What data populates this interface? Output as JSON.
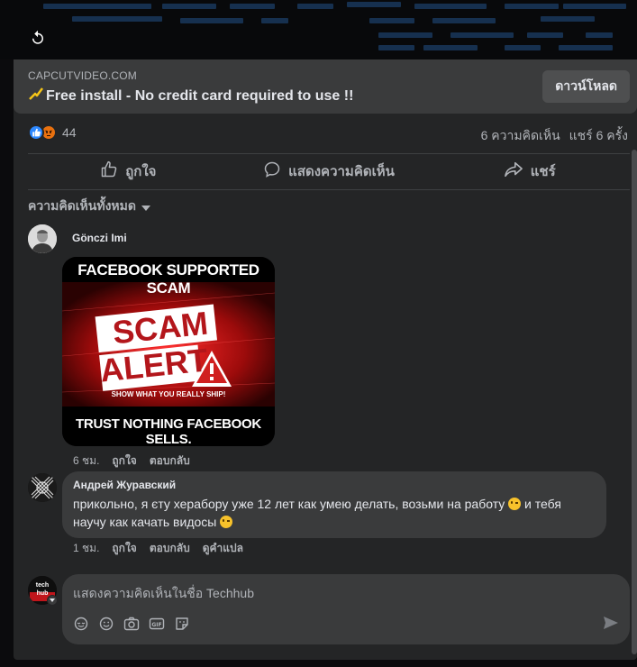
{
  "link": {
    "domain": "CAPCUTVIDEO.COM",
    "title": "Free install - No credit card required to use !!",
    "download_label": "ดาวน์โหลด"
  },
  "reactions": {
    "count": "44",
    "comments": "6 ความคิดเห็น",
    "shares": "แชร์ 6 ครั้ง"
  },
  "actions": {
    "like": "ถูกใจ",
    "comment": "แสดงความคิดเห็น",
    "share": "แชร์"
  },
  "sort_label": "ความคิดเห็นทั้งหมด",
  "comments": [
    {
      "author": "Gönczi Imi",
      "image_text": {
        "top": "FACEBOOK SUPPORTED SCAM",
        "scam": "SCAM",
        "alert": "ALERT",
        "tagline": "SHOW WHAT YOU REALLY SHIP!",
        "bottom": "TRUST NOTHING FACEBOOK SELLS."
      },
      "time": "6 ชม.",
      "like": "ถูกใจ",
      "reply": "ตอบกลับ"
    },
    {
      "author": "Андрей Журавский",
      "text_part1": "прикольно, я єту херабору уже 12 лет как умею делать, возьми на работу",
      "text_part2": " и тебя научу как качать видосы",
      "time": "1 ชม.",
      "like": "ถูกใจ",
      "reply": "ตอบกลับ",
      "translate": "ดูคำแปล"
    }
  ],
  "composer": {
    "placeholder": "แสดงความคิดเห็นในชื่อ Techhub",
    "avatar_text": "tech hub",
    "icons": [
      "sticker-icon",
      "emoji-icon",
      "camera-icon",
      "gif-icon",
      "avatar-sticker-icon",
      "send-icon"
    ]
  },
  "colors": {
    "card_bg": "#242526",
    "bubble_bg": "#3a3b3c",
    "like_blue": "#2e89ff",
    "angry_orange": "#e9710f",
    "scam_red": "#d01f1f"
  }
}
